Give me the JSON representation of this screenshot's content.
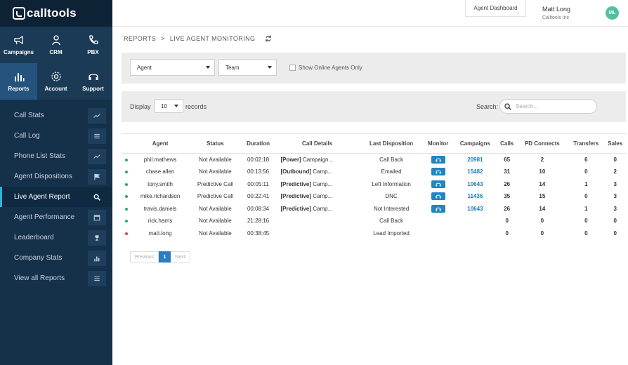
{
  "logo": {
    "text": "calltools"
  },
  "modules": [
    {
      "label": "Campaigns",
      "icon": "megaphone-icon",
      "active": false
    },
    {
      "label": "CRM",
      "icon": "person-icon",
      "active": false
    },
    {
      "label": "PBX",
      "icon": "phone-icon",
      "active": false
    },
    {
      "label": "Reports",
      "icon": "bar-chart-icon",
      "active": true
    },
    {
      "label": "Account",
      "icon": "gear-icon",
      "active": false
    },
    {
      "label": "Support",
      "icon": "headset-icon",
      "active": false
    }
  ],
  "nav": [
    {
      "label": "Call Stats",
      "icon": "trend-icon",
      "active": false
    },
    {
      "label": "Call Log",
      "icon": "list-icon",
      "active": false
    },
    {
      "label": "Phone List Stats",
      "icon": "trend-icon",
      "active": false
    },
    {
      "label": "Agent Dispositions",
      "icon": "flag-icon",
      "active": false
    },
    {
      "label": "Live Agent Report",
      "icon": "search-icon",
      "active": true
    },
    {
      "label": "Agent Performance",
      "icon": "calendar-icon",
      "active": false
    },
    {
      "label": "Leaderboard",
      "icon": "trophy-icon",
      "active": false
    },
    {
      "label": "Company Stats",
      "icon": "bars-icon",
      "active": false
    },
    {
      "label": "View all Reports",
      "icon": "list-icon",
      "active": false
    }
  ],
  "header": {
    "dashboard_button": "Agent Dashboard",
    "user_name": "Matt Long",
    "company": "Calltools Inc",
    "avatar_initials": "ML"
  },
  "breadcrumb": {
    "parent": "REPORTS",
    "separator": ">",
    "current": "LIVE AGENT MONITORING"
  },
  "filters": {
    "agent_select": "Agent",
    "team_select": "Team",
    "online_only_label": "Show Online Agents Only"
  },
  "display": {
    "label": "Display",
    "records_value": "10",
    "records_label": "records",
    "search_label": "Search:",
    "search_placeholder": "Search..."
  },
  "colors": {
    "online_dot": "#2aa772",
    "offline_dot": "#e0413a",
    "accent": "#1f86c4"
  },
  "table": {
    "columns": [
      "Agent",
      "Status",
      "Duration",
      "Call Details",
      "Last Disposition",
      "Monitor",
      "Campaigns",
      "Calls",
      "PD Connects",
      "Transfers",
      "Sales"
    ],
    "rows": [
      {
        "dot": "online",
        "agent": "phil.mathews",
        "status": "Not Available",
        "duration": "00:02:18",
        "details_tag": "[Power]",
        "details_text": " Campaign...",
        "disposition": "Call Back",
        "monitor": true,
        "campaign": "20981",
        "calls": "65",
        "pd": "2",
        "transfers": "6",
        "sales": "0"
      },
      {
        "dot": "online",
        "agent": "chase.allen",
        "status": "Not Available",
        "duration": "00:13:56",
        "details_tag": "[Outbound]",
        "details_text": " Camp...",
        "disposition": "Emailed",
        "monitor": true,
        "campaign": "15482",
        "calls": "31",
        "pd": "10",
        "transfers": "0",
        "sales": "2"
      },
      {
        "dot": "online",
        "agent": "tony.smith",
        "status": "Predictive Call",
        "duration": "00:05:11",
        "details_tag": "[Predictive]",
        "details_text": " Camp...",
        "disposition": "Left Information",
        "monitor": true,
        "campaign": "10643",
        "calls": "26",
        "pd": "14",
        "transfers": "1",
        "sales": "3"
      },
      {
        "dot": "online",
        "agent": "mike.richardson",
        "status": "Predictive Call",
        "duration": "00:22:41",
        "details_tag": "[Predictive]",
        "details_text": " Camp...",
        "disposition": "DNC",
        "monitor": true,
        "campaign": "11436",
        "calls": "35",
        "pd": "15",
        "transfers": "0",
        "sales": "3"
      },
      {
        "dot": "online",
        "agent": "travis.daniels",
        "status": "Not Available",
        "duration": "00:08:34",
        "details_tag": "[Predictive]",
        "details_text": " Camp...",
        "disposition": "Not Interested",
        "monitor": true,
        "campaign": "10643",
        "calls": "26",
        "pd": "14",
        "transfers": "1",
        "sales": "3"
      },
      {
        "dot": "online",
        "agent": "rick.harris",
        "status": "Not Available",
        "duration": "21:28:16",
        "details_tag": "",
        "details_text": "",
        "disposition": "Call Back",
        "monitor": false,
        "campaign": "",
        "calls": "0",
        "pd": "0",
        "transfers": "0",
        "sales": "0"
      },
      {
        "dot": "offline",
        "agent": "matt.long",
        "status": "Not Available",
        "duration": "00:38:45",
        "details_tag": "",
        "details_text": "",
        "disposition": "Lead Imported",
        "monitor": false,
        "campaign": "",
        "calls": "0",
        "pd": "0",
        "transfers": "0",
        "sales": "0"
      }
    ]
  },
  "pagination": {
    "previous": "Previous",
    "current": "1",
    "next": "Next"
  }
}
